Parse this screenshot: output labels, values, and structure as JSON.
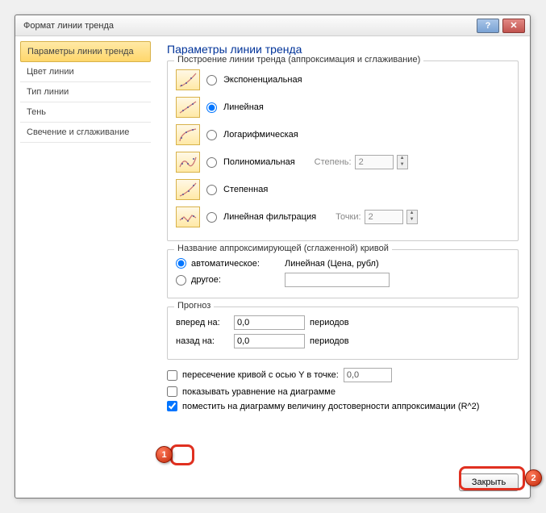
{
  "window": {
    "title": "Формат линии тренда"
  },
  "sidebar": {
    "items": [
      {
        "label": "Параметры линии тренда"
      },
      {
        "label": "Цвет линии"
      },
      {
        "label": "Тип линии"
      },
      {
        "label": "Тень"
      },
      {
        "label": "Свечение и сглаживание"
      }
    ]
  },
  "main": {
    "heading": "Параметры линии тренда",
    "group1": {
      "legend": "Построение линии тренда (аппроксимация и сглаживание)",
      "types": [
        {
          "label": "Экспоненциальная"
        },
        {
          "label": "Линейная"
        },
        {
          "label": "Логарифмическая"
        },
        {
          "label": "Полиномиальная",
          "extraLabel": "Степень:",
          "extraVal": "2"
        },
        {
          "label": "Степенная"
        },
        {
          "label": "Линейная фильтрация",
          "extraLabel": "Точки:",
          "extraVal": "2"
        }
      ]
    },
    "group2": {
      "legend": "Название аппроксимирующей (сглаженной) кривой",
      "auto": "автоматическое:",
      "autoValue": "Линейная (Цена, рубл)",
      "other": "другое:"
    },
    "group3": {
      "legend": "Прогноз",
      "fwdLabel": "вперед на:",
      "fwdVal": "0,0",
      "fwdUnit": "периодов",
      "backLabel": "назад на:",
      "backVal": "0,0",
      "backUnit": "периодов"
    },
    "checks": {
      "intercept": "пересечение кривой с осью Y в точке:",
      "interceptVal": "0,0",
      "showEq": "показывать уравнение на диаграмме",
      "showR2": "поместить на диаграмму величину достоверности аппроксимации (R^2)"
    },
    "closeLabel": "Закрыть"
  },
  "callouts": {
    "c1": "1",
    "c2": "2"
  }
}
